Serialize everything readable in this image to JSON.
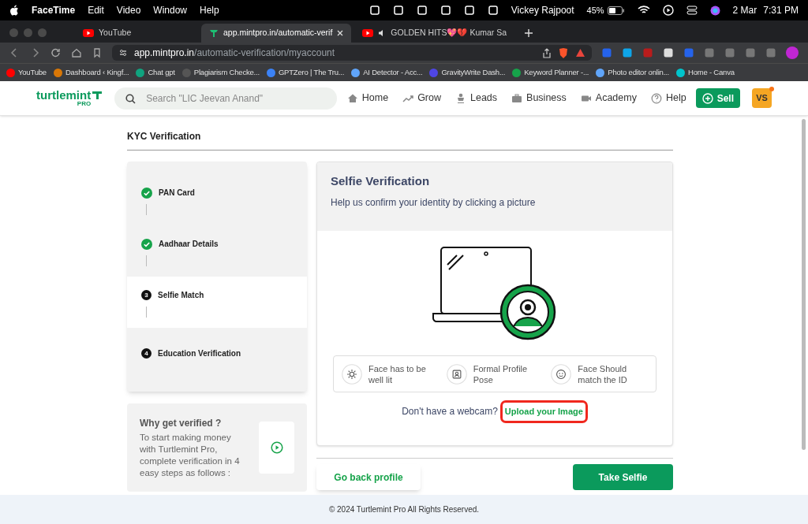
{
  "menu_bar": {
    "app": "FaceTime",
    "menus": [
      "Edit",
      "Video",
      "Window",
      "Help"
    ],
    "user": "Vickey Rajpoot",
    "battery": "45%",
    "date": "2 Mar",
    "time": "7:31 PM"
  },
  "browser": {
    "tabs": [
      {
        "label": "YouTube",
        "selected": false,
        "audio": false
      },
      {
        "label": "app.mintpro.in/automatic-verif",
        "selected": true,
        "audio": false
      },
      {
        "label": "GOLDEN HITS💖💔 Kumar Sa",
        "selected": false,
        "audio": true
      }
    ],
    "url_host": "app.mintpro.in",
    "url_path": "/automatic-verification/myaccount",
    "bookmarks": [
      "YouTube",
      "Dashboard ‹ Kingf...",
      "Chat gpt",
      "Plagiarism Checke...",
      "GPTZero | The Tru...",
      "AI Detector - Acc...",
      "GravityWrite Dash...",
      "Keyword Planner -...",
      "Photo editor onlin...",
      "Home - Canva"
    ]
  },
  "header": {
    "logo": "turtlemint",
    "logo_sub": "PRO",
    "search_placeholder": "Search \"LIC Jeevan Anand\"",
    "nav": [
      "Home",
      "Grow",
      "Leads",
      "Business",
      "Academy",
      "Help"
    ],
    "sell": "Sell",
    "avatar": "VS"
  },
  "page_title": "KYC Verification",
  "steps": [
    {
      "label": "PAN Card",
      "completed": true,
      "selected": false
    },
    {
      "label": "Aadhaar Details",
      "completed": true,
      "selected": false
    },
    {
      "label": "Selfie Match",
      "completed": false,
      "selected": true,
      "number": "3"
    },
    {
      "label": "Education Verification",
      "completed": false,
      "selected": false,
      "number": "4"
    }
  ],
  "why": {
    "title": "Why get verified ?",
    "text": "To start making money with Turtlemint Pro, complete verification in 4 easy steps as follows :"
  },
  "selfie": {
    "title": "Selfie Verification",
    "subtitle": "Help us confirm your identity by clicking a picture",
    "tips": [
      "Face has to be well lit",
      "Formal Profile Pose",
      "Face Should match the ID"
    ],
    "no_webcam": "Don't have a webcam?",
    "upload": "Upload your Image"
  },
  "buttons": {
    "back": "Go back profile",
    "take": "Take Selfie"
  },
  "footer": "© 2024 Turtlemint Pro All Rights Reserved."
}
